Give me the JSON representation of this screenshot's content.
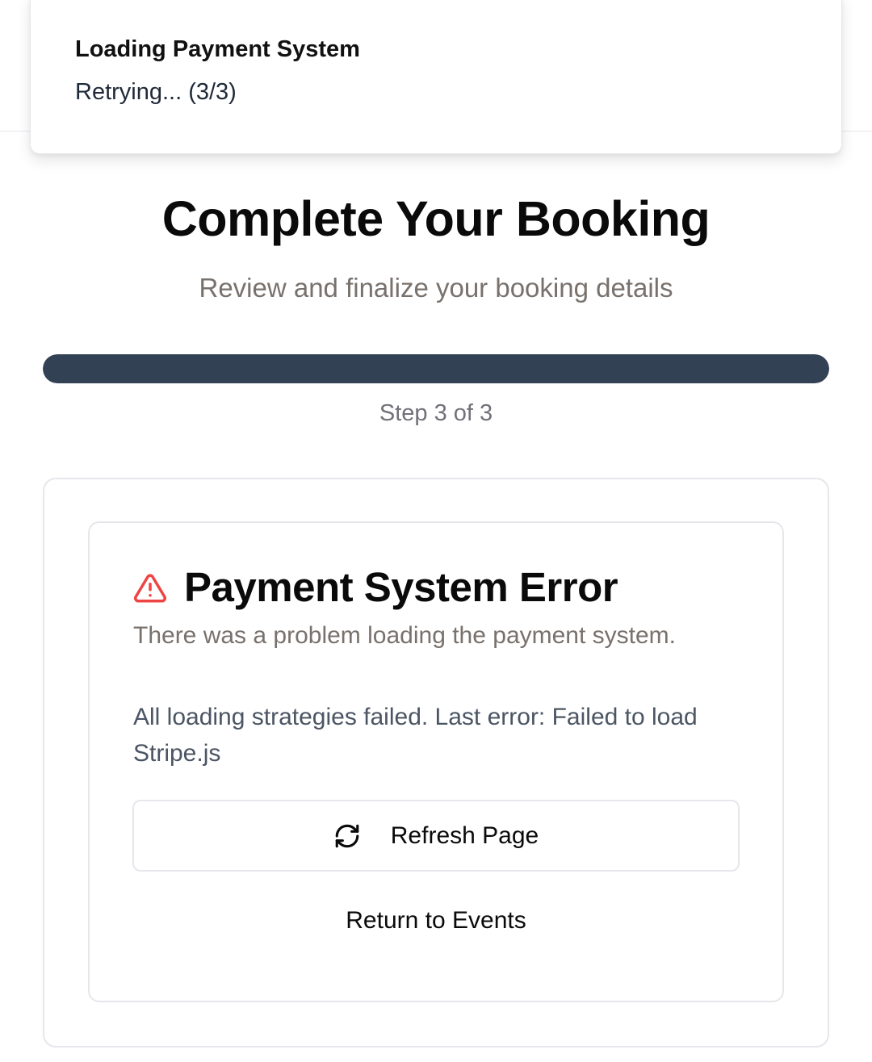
{
  "toast": {
    "title": "Loading Payment System",
    "description": "Retrying... (3/3)"
  },
  "header": {
    "title": "Complete Your Booking",
    "subtitle": "Review and finalize your booking details"
  },
  "progress": {
    "fraction": 1.0,
    "step_label": "Step 3 of 3"
  },
  "error": {
    "icon": "alert-triangle-icon",
    "title": "Payment System Error",
    "subtitle": "There was a problem loading the payment system.",
    "detail": "All loading strategies failed. Last error: Failed to load Stripe.js",
    "refresh_icon": "refresh-icon",
    "refresh_label": "Refresh Page",
    "return_label": "Return to Events"
  },
  "colors": {
    "progress_fill": "#334155",
    "warning": "#ef4444",
    "muted_text": "#78716c"
  }
}
